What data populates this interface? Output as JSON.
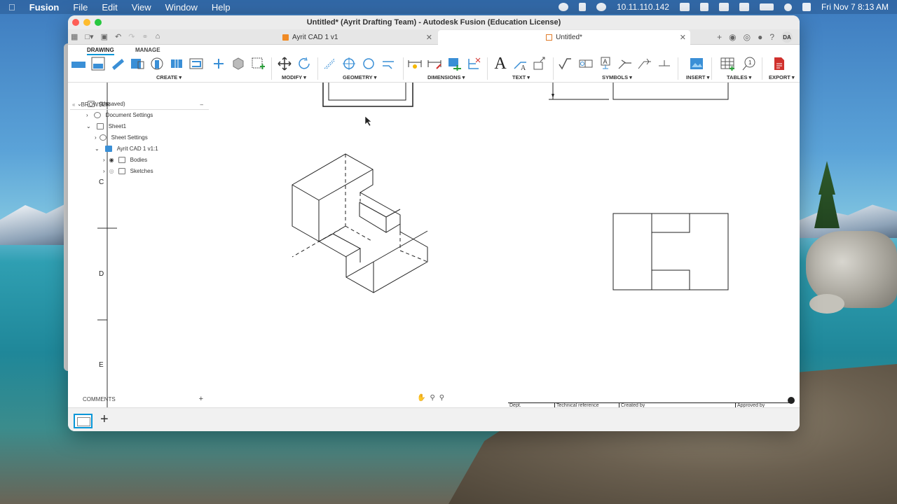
{
  "menubar": {
    "app": "Fusion",
    "menus": [
      "File",
      "Edit",
      "View",
      "Window",
      "Help"
    ],
    "ip": "10.11.110.142",
    "datetime": "Fri Nov 7  8:13 AM"
  },
  "window": {
    "title": "Untitled* (Ayrit Drafting Team) - Autodesk Fusion (Education License)"
  },
  "tabs": [
    {
      "label": "Ayrit CAD 1 v1",
      "active": false
    },
    {
      "label": "Untitled*",
      "active": true
    }
  ],
  "user": {
    "initials": "DA"
  },
  "ribbon": {
    "tabs": [
      "DRAWING",
      "MANAGE"
    ],
    "groups": [
      "CREATE ▾",
      "MODIFY ▾",
      "GEOMETRY ▾",
      "DIMENSIONS ▾",
      "TEXT ▾",
      "SYMBOLS ▾",
      "INSERT ▾",
      "TABLES ▾",
      "EXPORT ▾"
    ]
  },
  "browser": {
    "title": "BROWSER",
    "items": [
      "(Unsaved)",
      "Document Settings",
      "Sheet1",
      "Sheet Settings",
      "Ayrit CAD 1 v1:1",
      "Bodies",
      "Sketches"
    ]
  },
  "comments": {
    "label": "COMMENTS"
  },
  "drawing": {
    "zone_labels": [
      "C",
      "D",
      "E"
    ]
  },
  "titleblock": {
    "cells": [
      "Dept.",
      "Technical reference",
      "Created by",
      "Approved by"
    ]
  },
  "colors": {
    "accent": "#0696d7",
    "export": "#d0312d"
  }
}
